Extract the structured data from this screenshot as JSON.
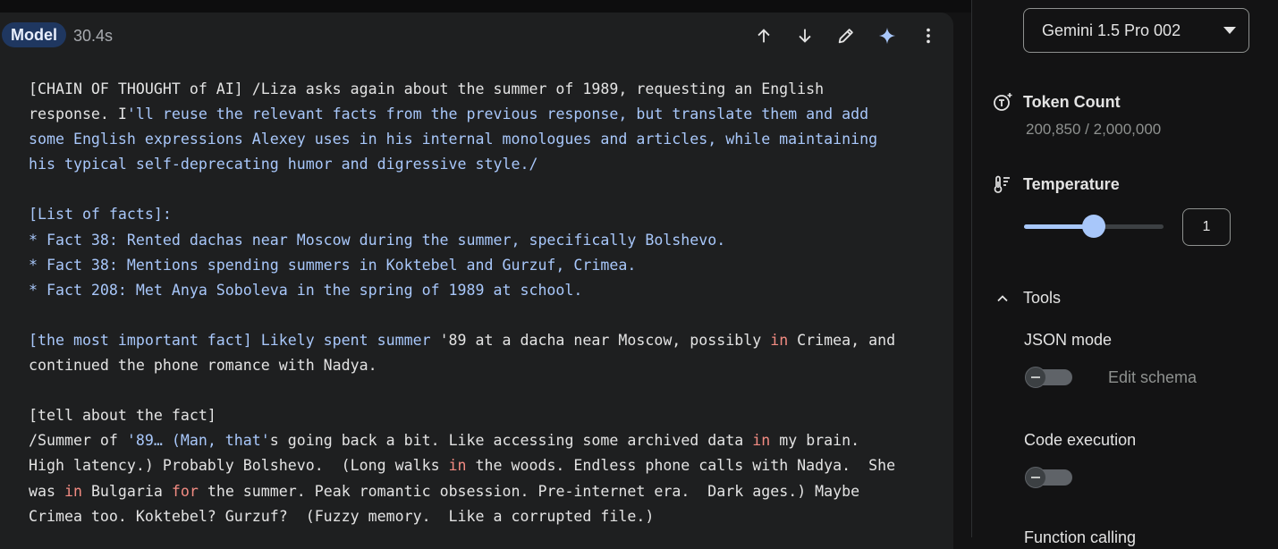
{
  "message": {
    "role": "Model",
    "duration": "30.4s",
    "segments": [
      {
        "t": "[CHAIN OF THOUGHT of AI] /Liza asks again about the summer of 1989, requesting an English\nresponse. I",
        "c": "n"
      },
      {
        "t": "'ll reuse the relevant facts from the previous response, but translate them and add\nsome English expressions Alexey uses in his internal monologues and articles, while maintaining\nhis typical self-deprecating humor and digressive style./\n\n[List of facts]:\n* Fact 38: Rented dachas near Moscow during the summer, specifically Bolshevo.\n* Fact 38: Mentions spending summers in Koktebel and Gurzuf, Crimea.\n* Fact 208: Met Anya Soboleva in the spring of 1989 at school.\n\n[the most important fact] Likely spent summer ",
        "c": "b"
      },
      {
        "t": "'89 at a dacha near Moscow, possibly ",
        "c": "n"
      },
      {
        "t": "in",
        "c": "r"
      },
      {
        "t": " Crimea, and\ncontinued the phone romance with Nadya.\n\n[tell about the fact]\n/Summer of ",
        "c": "n"
      },
      {
        "t": "'89… (Man, that'",
        "c": "b"
      },
      {
        "t": "s going back a bit. Like accessing some archived data ",
        "c": "n"
      },
      {
        "t": "in",
        "c": "r"
      },
      {
        "t": " my brain.\nHigh latency.) Probably Bolshevo.  (Long walks ",
        "c": "n"
      },
      {
        "t": "in",
        "c": "r"
      },
      {
        "t": " the woods. Endless phone calls with Nadya.  She\nwas ",
        "c": "n"
      },
      {
        "t": "in",
        "c": "r"
      },
      {
        "t": " Bulgaria ",
        "c": "n"
      },
      {
        "t": "for",
        "c": "r"
      },
      {
        "t": " the summer. Peak romantic obsession. Pre-internet era.  Dark ages.) Maybe\nCrimea too. Koktebel? Gurzuf?  (Fuzzy memory.  Like a corrupted file.)",
        "c": "n"
      }
    ]
  },
  "toolbar": {
    "icons": [
      "arrow-up-icon",
      "arrow-down-icon",
      "edit-pencil-icon",
      "gemini-sparkle-icon",
      "more-vert-icon"
    ]
  },
  "sidebar": {
    "model": "Gemini 1.5 Pro 002",
    "token_count": {
      "title": "Token Count",
      "value": "200,850 / 2,000,000"
    },
    "temperature": {
      "title": "Temperature",
      "value": "1",
      "fraction": 0.5
    },
    "tools": {
      "title": "Tools",
      "json_mode": {
        "title": "JSON mode",
        "enabled": false,
        "edit_schema": "Edit schema"
      },
      "code_execution": {
        "title": "Code execution",
        "enabled": false
      },
      "next_partial": "Function calling"
    }
  },
  "colors": {
    "accent": "#a8c7fa",
    "keyword": "#f28b82",
    "badge": "#1f3760"
  }
}
